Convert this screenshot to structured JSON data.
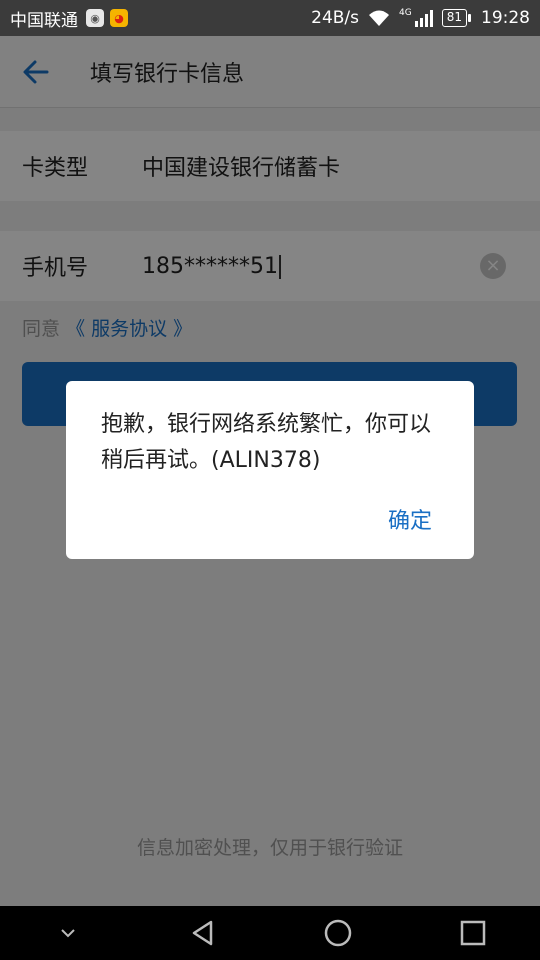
{
  "status_bar": {
    "carrier": "中国联通",
    "net_speed": "24B/s",
    "network_type": "4G",
    "battery": "81",
    "time": "19:28",
    "icons": [
      "app-notification-icon",
      "weibo-icon",
      "wifi-icon",
      "signal-icon",
      "battery-icon"
    ]
  },
  "header": {
    "title": "填写银行卡信息",
    "back_icon": "arrow-left-icon"
  },
  "form": {
    "card_type": {
      "label": "卡类型",
      "value": "中国建设银行储蓄卡"
    },
    "phone": {
      "label": "手机号",
      "value": "185******51",
      "clear_icon": "clear-circle-icon"
    }
  },
  "agreement": {
    "prefix": "同意",
    "link": "《 服务协议 》"
  },
  "footer_note": "信息加密处理，仅用于银行验证",
  "dialog": {
    "message": "抱歉，银行网络系统繁忙，你可以稍后再试。(ALIN378)",
    "ok_label": "确定"
  },
  "colors": {
    "accent": "#1a6fc4",
    "status_bar": "#3b3b3b",
    "background": "#f0f0f0"
  },
  "nav_bar": {
    "icons": [
      "chevron-down-icon",
      "back-triangle-icon",
      "home-circle-icon",
      "recents-square-icon"
    ]
  }
}
